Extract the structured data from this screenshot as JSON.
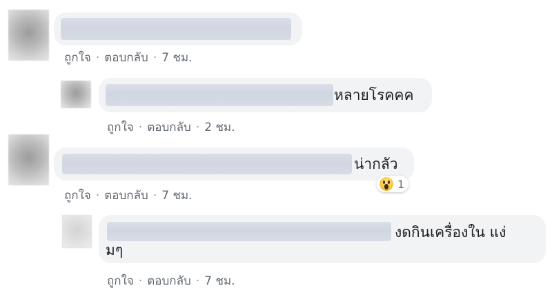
{
  "comments": [
    {
      "text": "",
      "actions": {
        "like": "ถูกใจ",
        "reply": "ตอบกลับ",
        "time": "7 ชม."
      }
    },
    {
      "text": "หลายโรคคค",
      "actions": {
        "like": "ถูกใจ",
        "reply": "ตอบกลับ",
        "time": "2 ชม."
      }
    },
    {
      "text": "น่ากลัว",
      "reaction": {
        "icon": "wow-icon",
        "count": "1"
      },
      "actions": {
        "like": "ถูกใจ",
        "reply": "ตอบกลับ",
        "time": "7 ชม."
      }
    },
    {
      "text_line1": "งดกินเครื่องใน แง่",
      "text_line2": "มๆ",
      "actions": {
        "like": "ถูกใจ",
        "reply": "ตอบกลับ",
        "time": "7 ชม."
      }
    }
  ],
  "separator": "·",
  "colors": {
    "bubble": "#f2f3f5",
    "meta_text": "#606770",
    "text": "#1c1e21"
  }
}
